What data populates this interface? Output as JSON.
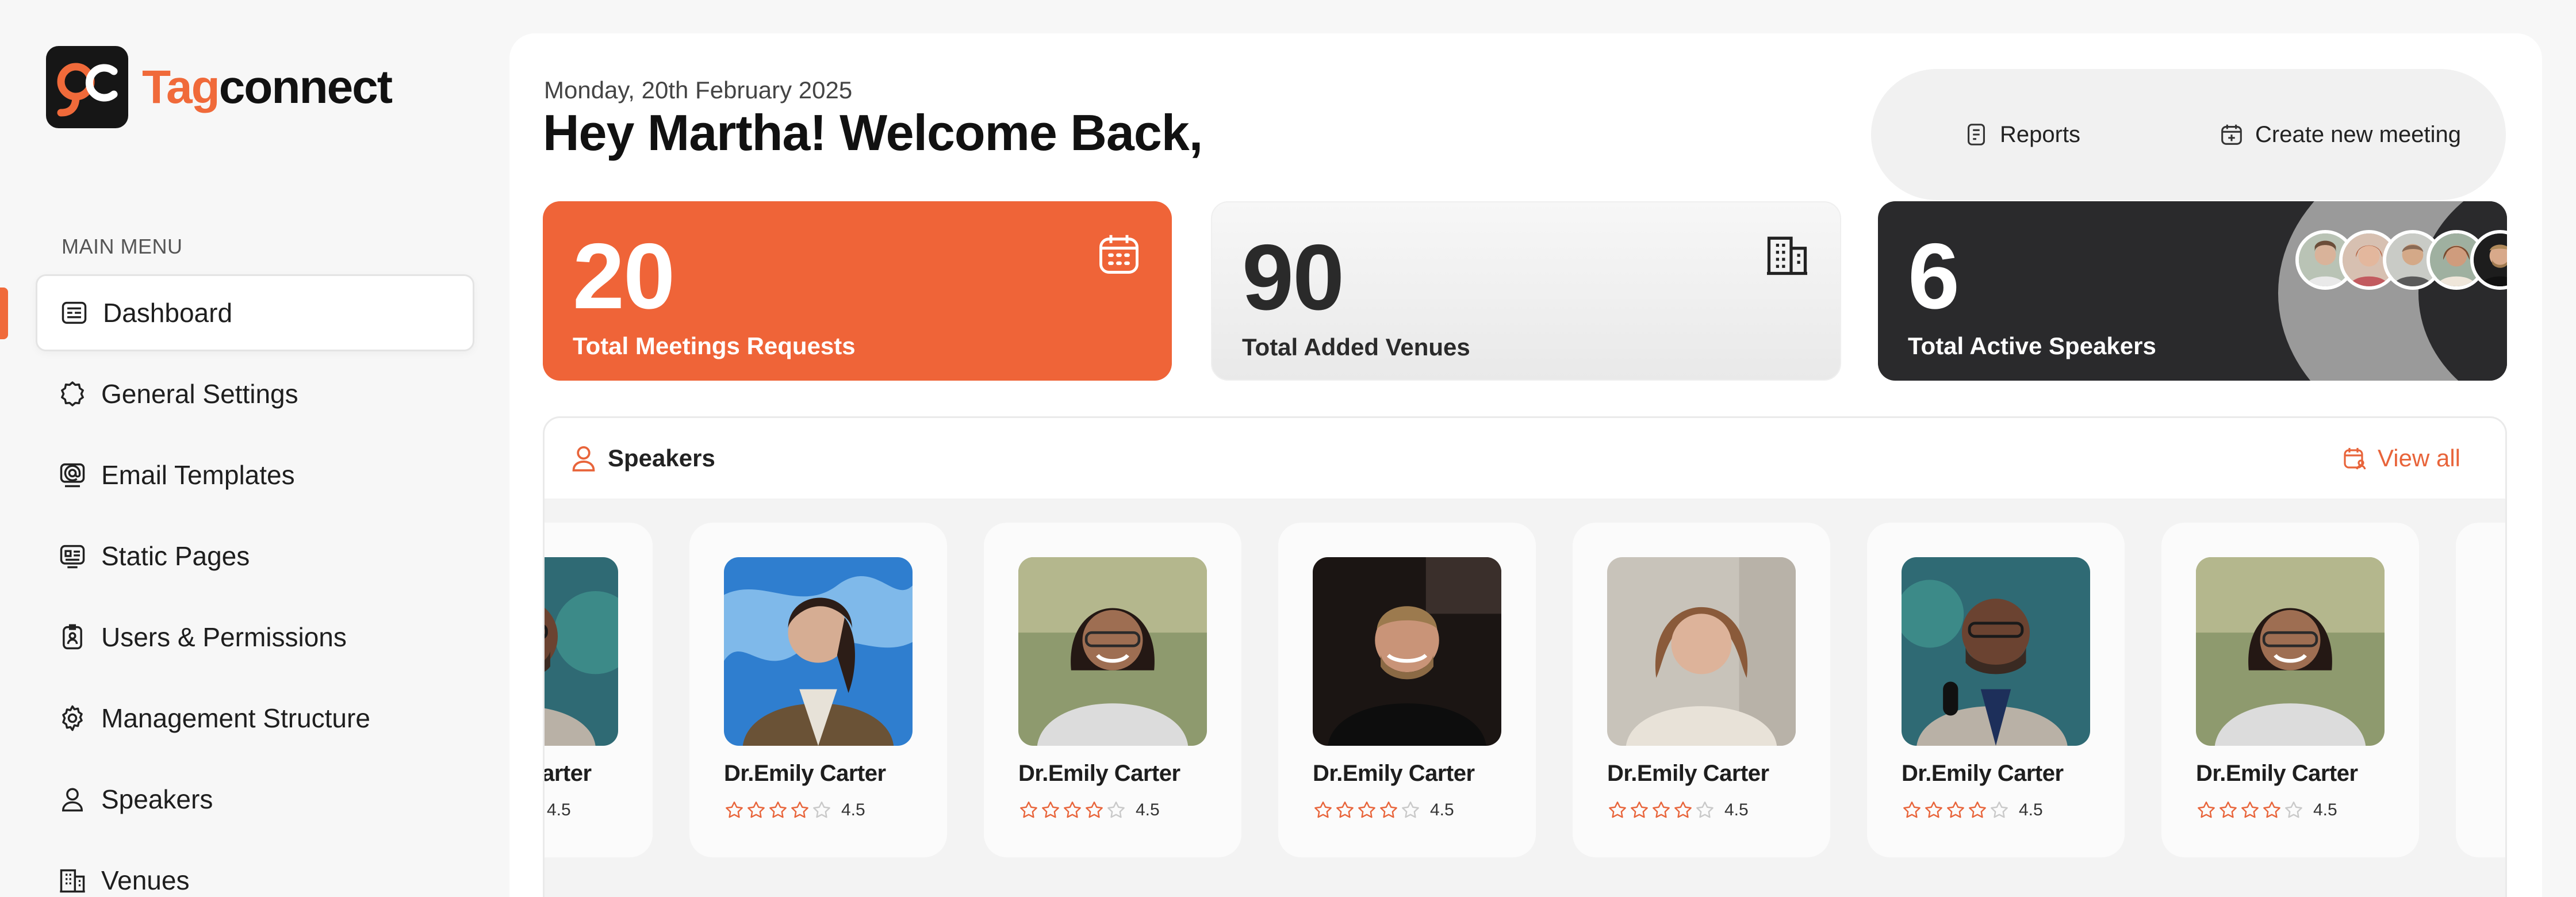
{
  "brand": {
    "name_part1": "Tag",
    "name_part2": "connect",
    "accent": "#f06a3a"
  },
  "sidebar": {
    "menu_title": "MAIN MENU",
    "items": [
      {
        "label": "Dashboard",
        "icon": "dashboard-icon",
        "active": true
      },
      {
        "label": "General Settings",
        "icon": "settings-badge-icon"
      },
      {
        "label": "Email Templates",
        "icon": "email-template-icon"
      },
      {
        "label": "Static Pages",
        "icon": "static-page-icon"
      },
      {
        "label": "Users & Permissions",
        "icon": "user-badge-icon"
      },
      {
        "label": "Management Structure",
        "icon": "gear-icon"
      },
      {
        "label": "Speakers",
        "icon": "speaker-user-icon"
      },
      {
        "label": "Venues",
        "icon": "building-icon"
      }
    ]
  },
  "header": {
    "date": "Monday, 20th February 2025",
    "welcome": "Hey Martha! Welcome Back,",
    "reports_label": "Reports",
    "create_meeting_label": "Create new meeting"
  },
  "stats": {
    "meetings": {
      "value": "20",
      "label": "Total Meetings Requests",
      "icon": "calendar-icon",
      "color": "#ef6438"
    },
    "venues": {
      "value": "90",
      "label": "Total Added Venues",
      "icon": "building-icon"
    },
    "speakers": {
      "value": "6",
      "label": "Total Active Speakers",
      "color": "#2a2a2c"
    }
  },
  "speakers": {
    "title": "Speakers",
    "view_all": "View all",
    "cards": [
      {
        "name": "Dr.Emily Carter",
        "rating": "4.5",
        "stars_filled": 4
      },
      {
        "name": "Dr.Emily Carter",
        "rating": "4.5",
        "stars_filled": 4
      },
      {
        "name": "Dr.Emily Carter",
        "rating": "4.5",
        "stars_filled": 4
      },
      {
        "name": "Dr.Emily Carter",
        "rating": "4.5",
        "stars_filled": 4
      },
      {
        "name": "Dr.Emily Carter",
        "rating": "4.5",
        "stars_filled": 4
      },
      {
        "name": "Dr.Emily Carter",
        "rating": "4.5",
        "stars_filled": 4
      },
      {
        "name": "Dr.Emily Carter",
        "rating": "4.5",
        "stars_filled": 4
      }
    ]
  }
}
